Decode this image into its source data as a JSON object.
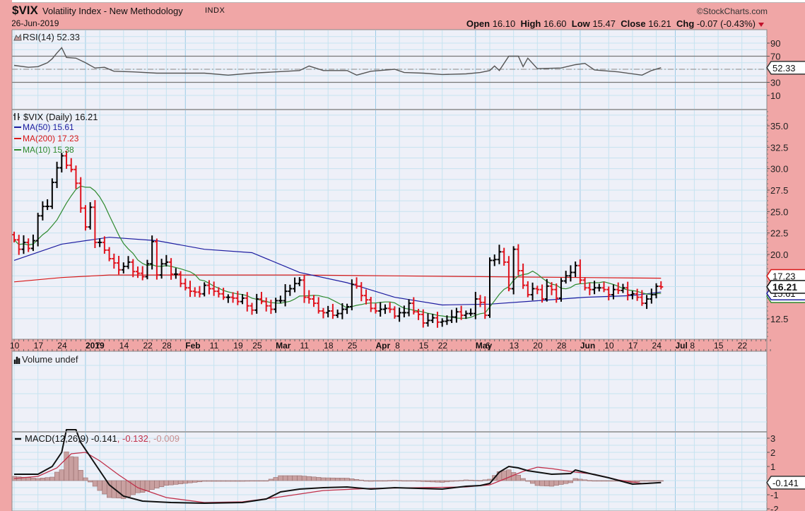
{
  "header": {
    "symbol": "$VIX",
    "name": "Volatility Index - New Methodology",
    "exchange": "INDX",
    "date": "26-Jun-2019",
    "brand": "©StockCharts.com",
    "open_label": "Open",
    "open": "16.10",
    "high_label": "High",
    "high": "16.60",
    "low_label": "Low",
    "low": "15.47",
    "close_label": "Close",
    "close": "16.21",
    "chg_label": "Chg",
    "chg": "-0.07 (-0.43%)"
  },
  "colors": {
    "background": "#f0a6a6",
    "plot": "#eef0f8",
    "up": "#000000",
    "down": "#e0141e",
    "ma50": "#1c1ca0",
    "ma200": "#d81818",
    "ma10": "#2f8a2f",
    "signal": "#c0304a",
    "hist": "#c9a0a0"
  },
  "panels": {
    "rsi": {
      "legend": "RSI(14) 52.33",
      "ticks": [
        "90",
        "70",
        "30",
        "10"
      ],
      "tick_values": [
        90,
        70,
        30,
        10
      ],
      "tag": "52.33"
    },
    "price": {
      "legend": "$VIX (Daily) 16.21",
      "ma50_legend": "MA(50) 15.61",
      "ma200_legend": "MA(200) 17.23",
      "ma10_legend": "MA(10) 15.38",
      "ticks": [
        "35.0",
        "32.5",
        "30.0",
        "27.5",
        "25.0",
        "22.5",
        "20.0",
        "17.5",
        "15.0",
        "12.5"
      ],
      "tick_values": [
        35,
        32.5,
        30,
        27.5,
        25,
        22.5,
        20,
        17.5,
        15,
        12.5
      ],
      "tags": {
        "ma200": "17.23",
        "close": "16.21",
        "ma50": "15.61",
        "ma10": "15.38"
      }
    },
    "volume": {
      "legend": "Volume undef"
    },
    "macd": {
      "legend_main": "MACD(12,26,9) -0.141",
      "legend_signal": ", -0.132",
      "legend_hist": ", -0.009",
      "ticks": [
        "3",
        "2",
        "1",
        "-1",
        "-2"
      ],
      "tick_values": [
        3,
        2,
        1,
        -1,
        -2
      ],
      "tag": "-0.141"
    }
  },
  "x_axis": [
    {
      "label": "10",
      "day": 0
    },
    {
      "label": "17",
      "day": 5
    },
    {
      "label": "24",
      "day": 10
    },
    {
      "label": "2019",
      "day": 15,
      "bold": true
    },
    {
      "label": "7",
      "day": 18
    },
    {
      "label": "14",
      "day": 23
    },
    {
      "label": "22",
      "day": 28
    },
    {
      "label": "28",
      "day": 32
    },
    {
      "label": "Feb",
      "day": 36,
      "bold": true
    },
    {
      "label": "11",
      "day": 42
    },
    {
      "label": "19",
      "day": 47
    },
    {
      "label": "25",
      "day": 51
    },
    {
      "label": "Mar",
      "day": 55,
      "bold": true
    },
    {
      "label": "11",
      "day": 61
    },
    {
      "label": "18",
      "day": 66
    },
    {
      "label": "25",
      "day": 71
    },
    {
      "label": "Apr",
      "day": 76,
      "bold": true
    },
    {
      "label": "8",
      "day": 81
    },
    {
      "label": "15",
      "day": 86
    },
    {
      "label": "22",
      "day": 90
    },
    {
      "label": "May",
      "day": 97,
      "bold": true
    },
    {
      "label": "6",
      "day": 100
    },
    {
      "label": "13",
      "day": 105
    },
    {
      "label": "20",
      "day": 110
    },
    {
      "label": "28",
      "day": 115
    },
    {
      "label": "Jun",
      "day": 119,
      "bold": true
    },
    {
      "label": "10",
      "day": 125
    },
    {
      "label": "17",
      "day": 130
    },
    {
      "label": "24",
      "day": 135
    },
    {
      "label": "Jul",
      "day": 139,
      "bold": true
    },
    {
      "label": "8",
      "day": 143
    },
    {
      "label": "15",
      "day": 148
    },
    {
      "label": "22",
      "day": 153
    }
  ],
  "chart_data": {
    "type": "line",
    "title": "$VIX Volatility Index - New Methodology (Daily)",
    "x_range_trading_days": [
      0,
      160
    ],
    "price": {
      "ylim": [
        11.3,
        36.3
      ],
      "closes": [
        21.7,
        20.6,
        21.4,
        20.7,
        21.6,
        24.5,
        25.6,
        25.6,
        28.4,
        30.1,
        31.5,
        30.4,
        29.9,
        28.3,
        25.4,
        23.2,
        25.5,
        21.4,
        21.4,
        20.5,
        19.5,
        19.0,
        18.2,
        18.6,
        19.1,
        18.0,
        17.8,
        17.4,
        18.9,
        21.5,
        17.6,
        18.9,
        19.1,
        17.7,
        17.7,
        16.6,
        16.1,
        15.7,
        15.6,
        15.4,
        16.4,
        16.0,
        15.7,
        15.4,
        15.0,
        15.0,
        14.9,
        14.5,
        14.9,
        14.0,
        13.5,
        14.8,
        14.5,
        14.0,
        13.6,
        14.6,
        14.6,
        15.7,
        16.0,
        16.6,
        17.0,
        15.0,
        14.8,
        14.3,
        13.4,
        13.2,
        13.4,
        12.9,
        13.1,
        13.6,
        13.9,
        16.5,
        16.3,
        15.2,
        14.7,
        13.7,
        13.4,
        13.6,
        13.7,
        13.6,
        12.8,
        13.2,
        13.2,
        14.3,
        13.3,
        13.0,
        12.0,
        12.3,
        12.6,
        12.1,
        12.2,
        12.3,
        12.7,
        13.3,
        12.9,
        13.1,
        13.1,
        14.8,
        14.4,
        12.9,
        19.3,
        19.4,
        20.3,
        19.1,
        16.0,
        20.6,
        18.1,
        16.4,
        15.3,
        16.0,
        15.9,
        14.8,
        16.3,
        15.9,
        14.9,
        16.9,
        17.5,
        17.9,
        18.7,
        17.0,
        16.1,
        15.9,
        16.1,
        16.1,
        15.9,
        15.3,
        15.9,
        15.8,
        16.1,
        15.3,
        15.4,
        15.0,
        14.3,
        14.8,
        15.3,
        16.28,
        16.21
      ],
      "ma50": [
        [
          0,
          19.3
        ],
        [
          10,
          21.2
        ],
        [
          20,
          22.0
        ],
        [
          30,
          21.6
        ],
        [
          40,
          20.6
        ],
        [
          50,
          20.2
        ],
        [
          60,
          17.9
        ],
        [
          70,
          16.7
        ],
        [
          80,
          15.0
        ],
        [
          90,
          14.1
        ],
        [
          100,
          14.2
        ],
        [
          110,
          14.6
        ],
        [
          120,
          15.0
        ],
        [
          130,
          15.2
        ],
        [
          136,
          15.61
        ]
      ],
      "ma200": [
        [
          0,
          16.8
        ],
        [
          10,
          17.3
        ],
        [
          20,
          17.6
        ],
        [
          40,
          17.6
        ],
        [
          60,
          17.6
        ],
        [
          80,
          17.5
        ],
        [
          100,
          17.4
        ],
        [
          120,
          17.3
        ],
        [
          136,
          17.23
        ]
      ]
    },
    "rsi": {
      "ylim": [
        0,
        100
      ],
      "overbought": 70,
      "oversold": 30,
      "points": [
        [
          0,
          56
        ],
        [
          3,
          53
        ],
        [
          5,
          54
        ],
        [
          7,
          60
        ],
        [
          8,
          66
        ],
        [
          9,
          75
        ],
        [
          10,
          83
        ],
        [
          11,
          68
        ],
        [
          13,
          67
        ],
        [
          15,
          60
        ],
        [
          17,
          52
        ],
        [
          19,
          53
        ],
        [
          21,
          47
        ],
        [
          25,
          46
        ],
        [
          30,
          44
        ],
        [
          35,
          44
        ],
        [
          40,
          44
        ],
        [
          45,
          41
        ],
        [
          50,
          44
        ],
        [
          55,
          46
        ],
        [
          60,
          48
        ],
        [
          62,
          55
        ],
        [
          65,
          48
        ],
        [
          70,
          48
        ],
        [
          72,
          41
        ],
        [
          75,
          47
        ],
        [
          80,
          50
        ],
        [
          82,
          45
        ],
        [
          86,
          44
        ],
        [
          90,
          42
        ],
        [
          95,
          43
        ],
        [
          98,
          45
        ],
        [
          100,
          48
        ],
        [
          101,
          55
        ],
        [
          102,
          48
        ],
        [
          104,
          70
        ],
        [
          106,
          70
        ],
        [
          107,
          54
        ],
        [
          108,
          67
        ],
        [
          110,
          51
        ],
        [
          115,
          52
        ],
        [
          118,
          57
        ],
        [
          120,
          59
        ],
        [
          122,
          49
        ],
        [
          127,
          46
        ],
        [
          132,
          41
        ],
        [
          134,
          48
        ],
        [
          136,
          52.33
        ]
      ]
    },
    "macd": {
      "ylim": [
        -2.2,
        3.4
      ],
      "macd": [
        [
          0,
          0.45
        ],
        [
          5,
          0.45
        ],
        [
          8,
          1.0
        ],
        [
          10,
          2.0
        ],
        [
          11,
          3.6
        ],
        [
          13,
          3.6
        ],
        [
          14,
          2.7
        ],
        [
          17,
          1.2
        ],
        [
          20,
          -0.3
        ],
        [
          23,
          -1.1
        ],
        [
          27,
          -1.45
        ],
        [
          33,
          -1.55
        ],
        [
          40,
          -1.6
        ],
        [
          48,
          -1.55
        ],
        [
          53,
          -1.3
        ],
        [
          56,
          -0.8
        ],
        [
          60,
          -0.6
        ],
        [
          65,
          -0.5
        ],
        [
          70,
          -0.45
        ],
        [
          75,
          -0.6
        ],
        [
          80,
          -0.5
        ],
        [
          85,
          -0.55
        ],
        [
          90,
          -0.6
        ],
        [
          95,
          -0.4
        ],
        [
          98,
          -0.35
        ],
        [
          100,
          -0.2
        ],
        [
          102,
          0.6
        ],
        [
          104,
          1.0
        ],
        [
          106,
          0.9
        ],
        [
          108,
          0.7
        ],
        [
          110,
          0.6
        ],
        [
          113,
          0.45
        ],
        [
          117,
          0.5
        ],
        [
          118,
          0.75
        ],
        [
          121,
          0.5
        ],
        [
          125,
          0.2
        ],
        [
          130,
          -0.25
        ],
        [
          133,
          -0.2
        ],
        [
          136,
          -0.141
        ]
      ],
      "signal": [
        [
          0,
          0.15
        ],
        [
          5,
          0.3
        ],
        [
          9,
          0.9
        ],
        [
          12,
          1.9
        ],
        [
          15,
          2.0
        ],
        [
          18,
          1.4
        ],
        [
          22,
          0.4
        ],
        [
          26,
          -0.5
        ],
        [
          32,
          -1.2
        ],
        [
          40,
          -1.55
        ],
        [
          48,
          -1.5
        ],
        [
          56,
          -1.15
        ],
        [
          65,
          -0.7
        ],
        [
          75,
          -0.55
        ],
        [
          85,
          -0.5
        ],
        [
          95,
          -0.45
        ],
        [
          100,
          -0.3
        ],
        [
          103,
          0.1
        ],
        [
          107,
          0.65
        ],
        [
          110,
          0.95
        ],
        [
          113,
          0.85
        ],
        [
          118,
          0.6
        ],
        [
          122,
          0.45
        ],
        [
          127,
          0.05
        ],
        [
          132,
          -0.2
        ],
        [
          136,
          -0.132
        ]
      ]
    }
  }
}
